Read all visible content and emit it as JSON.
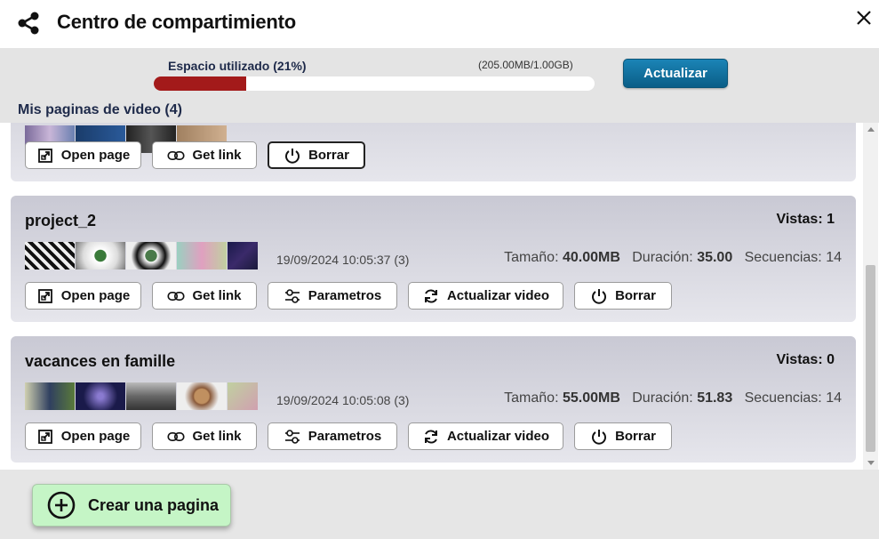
{
  "header": {
    "title": "Centro de compartimiento"
  },
  "storage": {
    "label": "Espacio utilizado (21%)",
    "size": "(205.00MB/1.00GB)",
    "used_percent": 21,
    "update_label": "Actualizar",
    "bar_color": "#a31a1a"
  },
  "list": {
    "title": "Mis paginas de video (4)"
  },
  "labels": {
    "size": "Tamaño:",
    "duration": "Duración:",
    "sequences": "Secuencias:",
    "open_page": "Open page",
    "get_link": "Get link",
    "params": "Parametros",
    "update_video": "Actualizar video",
    "delete": "Borrar"
  },
  "cards": [
    {},
    {
      "name": "project_2",
      "views": "Vistas: 1",
      "date": "19/09/2024 10:05:37 (3)",
      "size": "40.00MB",
      "duration": "35.00",
      "sequences": "14"
    },
    {
      "name": "vacances en famille",
      "views": "Vistas: 0",
      "date": "19/09/2024 10:05:08 (3)",
      "size": "55.00MB",
      "duration": "51.83",
      "sequences": "14"
    }
  ],
  "footer": {
    "create_label": "Crear una pagina"
  }
}
